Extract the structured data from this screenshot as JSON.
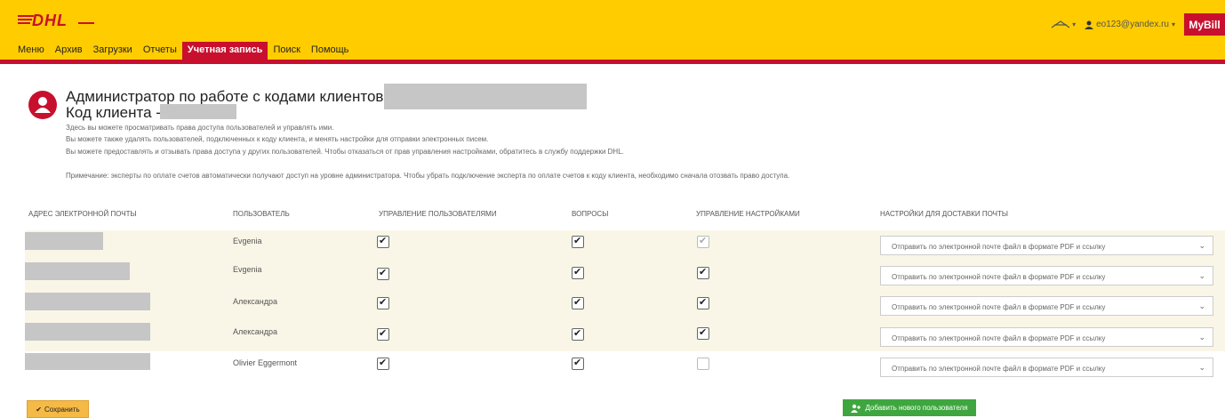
{
  "header": {
    "logo_text": "DHL",
    "user_email": "eo123@yandex.ru",
    "mybill_label": "MyBill",
    "nav": [
      {
        "label": "Меню"
      },
      {
        "label": "Архив"
      },
      {
        "label": "Загрузки"
      },
      {
        "label": "Отчеты"
      },
      {
        "label": "Учетная запись"
      },
      {
        "label": "Поиск"
      },
      {
        "label": "Помощь"
      }
    ],
    "active_nav": "Учетная запись"
  },
  "page": {
    "title_line1": "Администратор по работе с кодами клиентов -",
    "title_line2": "Код клиента -",
    "desc": [
      "Здесь вы можете просматривать права доступа пользователей и управлять ими.",
      "Вы можете также удалять пользователей, подключенных к коду клиента, и менять настройки для отправки электронных писем.",
      "Вы можете предоставлять и отзывать права доступа у других пользователей. Чтобы отказаться от прав управления настройками, обратитесь в службу поддержки DHL."
    ],
    "note": "Примечание: эксперты по оплате счетов автоматически получают доступ на уровне администратора. Чтобы убрать подключение эксперта по оплате счетов к коду клиента, необходимо сначала отозвать право доступа."
  },
  "table": {
    "headers": {
      "email": "Адрес электронной почты",
      "user": "Пользователь",
      "user_mgmt": "Управление пользователями",
      "questions": "Вопросы",
      "settings_mgmt": "Управление настройками",
      "delivery": "Настройки для доставки почты"
    },
    "rows": [
      {
        "user": "Evgenia",
        "user_mgmt": true,
        "questions": true,
        "settings_mgmt": true,
        "settings_disabled": true,
        "delivery": "Отправить по электронной почте файл в формате PDF и ссылку"
      },
      {
        "user": "Evgenia",
        "user_mgmt": true,
        "questions": true,
        "settings_mgmt": true,
        "settings_disabled": false,
        "delivery": "Отправить по электронной почте файл в формате PDF и ссылку"
      },
      {
        "user": "Александра",
        "user_mgmt": true,
        "questions": true,
        "settings_mgmt": true,
        "settings_disabled": false,
        "delivery": "Отправить по электронной почте файл в формате PDF и ссылку"
      },
      {
        "user": "Александра",
        "user_mgmt": true,
        "questions": true,
        "settings_mgmt": true,
        "settings_disabled": false,
        "delivery": "Отправить по электронной почте файл в формате PDF и ссылку"
      },
      {
        "user": "Olivier Eggermont",
        "user_mgmt": true,
        "questions": true,
        "settings_mgmt": false,
        "settings_disabled": true,
        "delivery": "Отправить по электронной почте файл в формате PDF и ссылку"
      }
    ]
  },
  "buttons": {
    "save": "Сохранить",
    "add_user": "Добавить нового пользователя"
  }
}
